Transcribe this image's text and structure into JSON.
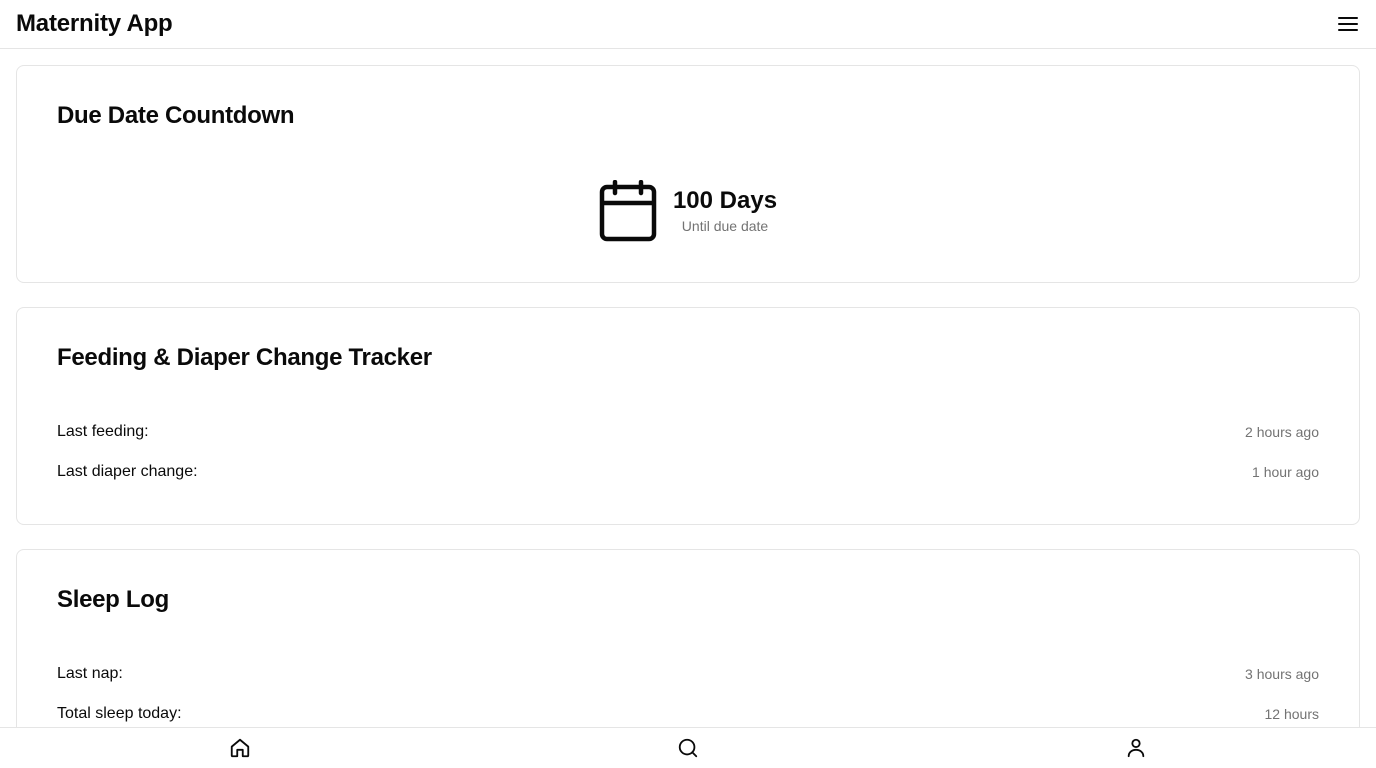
{
  "header": {
    "title": "Maternity App",
    "menu_icon": "hamburger-menu-icon"
  },
  "due_date": {
    "title": "Due Date Countdown",
    "icon": "calendar-icon",
    "value": "100 Days",
    "subtitle": "Until due date"
  },
  "feeding": {
    "title": "Feeding & Diaper Change Tracker",
    "rows": [
      {
        "label": "Last feeding:",
        "value": "2 hours ago"
      },
      {
        "label": "Last diaper change:",
        "value": "1 hour ago"
      }
    ]
  },
  "sleep": {
    "title": "Sleep Log",
    "rows": [
      {
        "label": "Last nap:",
        "value": "3 hours ago"
      },
      {
        "label": "Total sleep today:",
        "value": "12 hours"
      }
    ]
  },
  "bottom_nav": {
    "items": [
      {
        "icon": "home-icon"
      },
      {
        "icon": "search-icon"
      },
      {
        "icon": "user-icon"
      }
    ]
  },
  "colors": {
    "text": "#0a0a0a",
    "muted": "#737373",
    "border": "#e5e5e5",
    "background": "#ffffff"
  }
}
